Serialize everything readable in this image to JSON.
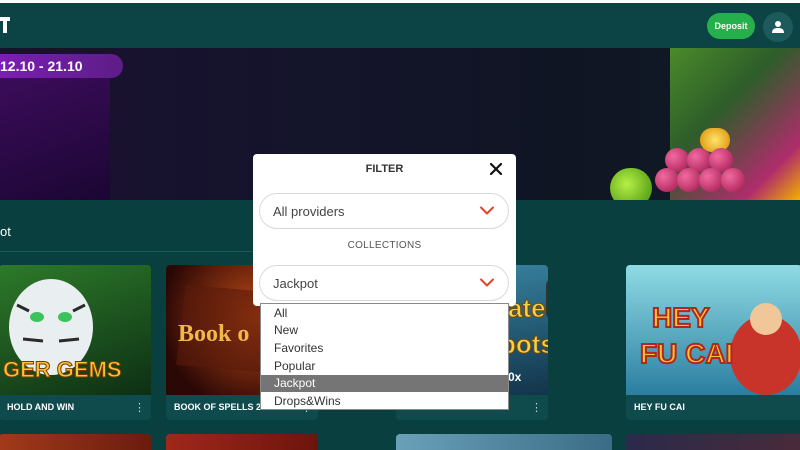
{
  "header": {
    "deposit_label": "Deposit",
    "user_icon": "user-icon"
  },
  "banner": {
    "date_range": "12.10 - 21.10"
  },
  "section": {
    "title": "ot"
  },
  "games": [
    {
      "name": "HOLD AND WIN",
      "art_text": "GER GEMS",
      "colors": [
        "#1c5a1e",
        "#0d2f14"
      ]
    },
    {
      "name": "BOOK OF SPELLS 2",
      "art_text": "Book o",
      "colors": [
        "#6b1b0f",
        "#2a0806"
      ]
    },
    {
      "name": "",
      "art_text": "ate pots",
      "colors": [
        "#2e6e8a",
        "#12344a"
      ]
    },
    {
      "name": "HEY FU CAI",
      "art_text": "HEY FU CAI",
      "colors": [
        "#6fc9d6",
        "#2b7ea0"
      ]
    }
  ],
  "filter_modal": {
    "title": "FILTER",
    "providers_value": "All providers",
    "collections_label": "COLLECTIONS",
    "collections_value": "Jackpot"
  },
  "dropdown": {
    "options": [
      "All",
      "New",
      "Favorites",
      "Popular",
      "Jackpot",
      "Drops&Wins"
    ],
    "selected": "Jackpot"
  },
  "colors": {
    "background": "#0a3f40",
    "deposit_green": "#26b04b",
    "chevron_red": "#e0452b",
    "selected_option": "#757575"
  }
}
